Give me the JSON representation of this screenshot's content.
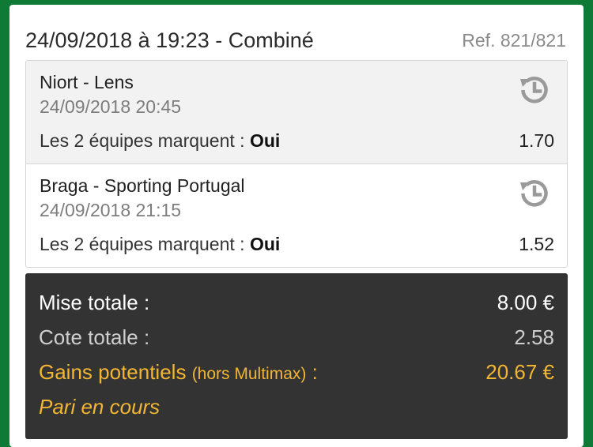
{
  "bet": {
    "title": "24/09/2018 à 19:23 - Combiné",
    "reference": "Ref. 821/821"
  },
  "selections": [
    {
      "match": "Niort - Lens",
      "datetime": "24/09/2018 20:45",
      "market_label": "Les 2 équipes marquent : ",
      "market_choice": "Oui",
      "odds": "1.70",
      "icon": "history-icon"
    },
    {
      "match": "Braga - Sporting Portugal",
      "datetime": "24/09/2018 21:15",
      "market_label": "Les 2 équipes marquent : ",
      "market_choice": "Oui",
      "odds": "1.52",
      "icon": "history-icon"
    }
  ],
  "summary": {
    "stake_label": "Mise totale :",
    "stake_value": "8.00 €",
    "total_odds_label": "Cote totale :",
    "total_odds_value": "2.58",
    "potential_gains_label": "Gains potentiels",
    "potential_gains_note": "(hors Multimax)",
    "potential_gains_colon": " :",
    "potential_gains_value": "20.67 €",
    "status": "Pari en cours"
  },
  "colors": {
    "background_green": "#0e7a36",
    "summary_dark": "#333333",
    "highlight_gold": "#f2b632",
    "icon_grey": "#9a9a9a"
  }
}
